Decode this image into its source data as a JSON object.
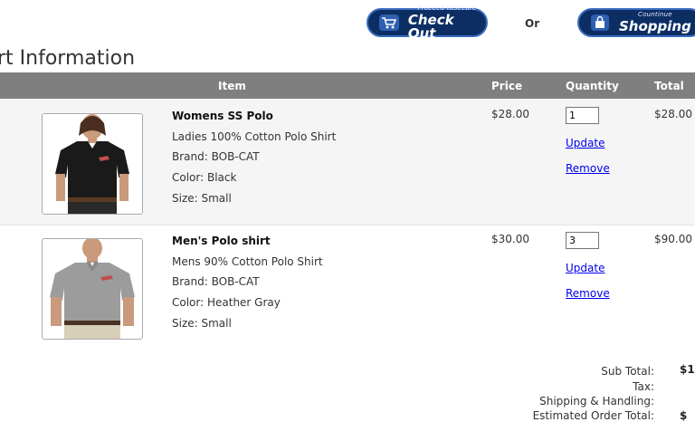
{
  "header": {
    "checkout": {
      "small": "Proceed toSecure",
      "big": "Check Out",
      "icon": "cart-icon"
    },
    "or_text": "Or",
    "continue": {
      "small": "Countinue",
      "big": "Shopping",
      "icon": "bag-icon"
    }
  },
  "cart": {
    "title": "rt Information",
    "columns": {
      "item": "Item",
      "price": "Price",
      "quantity": "Quantity",
      "total": "Total"
    },
    "items": [
      {
        "name": "Womens SS Polo",
        "desc": "Ladies 100% Cotton Polo Shirt",
        "brand": "Brand: BOB-CAT",
        "color": "Color: Black",
        "size": "Size: Small",
        "price": "$28.00",
        "qty": "1",
        "update": "Update",
        "remove": "Remove",
        "total": "$28.00",
        "shirt_color": "#1a1a1a"
      },
      {
        "name": "Men's Polo shirt",
        "desc": "Mens 90% Cotton Polo Shirt",
        "brand": "Brand: BOB-CAT",
        "color": "Color: Heather Gray",
        "size": "Size: Small",
        "price": "$30.00",
        "qty": "3",
        "update": "Update",
        "remove": "Remove",
        "total": "$90.00",
        "shirt_color": "#9c9c9c"
      }
    ]
  },
  "summary": {
    "subtotal_label": "Sub Total:",
    "subtotal_value": "$1",
    "tax_label": "Tax:",
    "shipping_label": "Shipping & Handling:",
    "order_total_label": "Estimated Order Total:",
    "order_total_value": "$"
  },
  "colors": {
    "header_bg": "#7f7f7f",
    "button_bg": "#0c2e63",
    "link": "#0000ee"
  }
}
